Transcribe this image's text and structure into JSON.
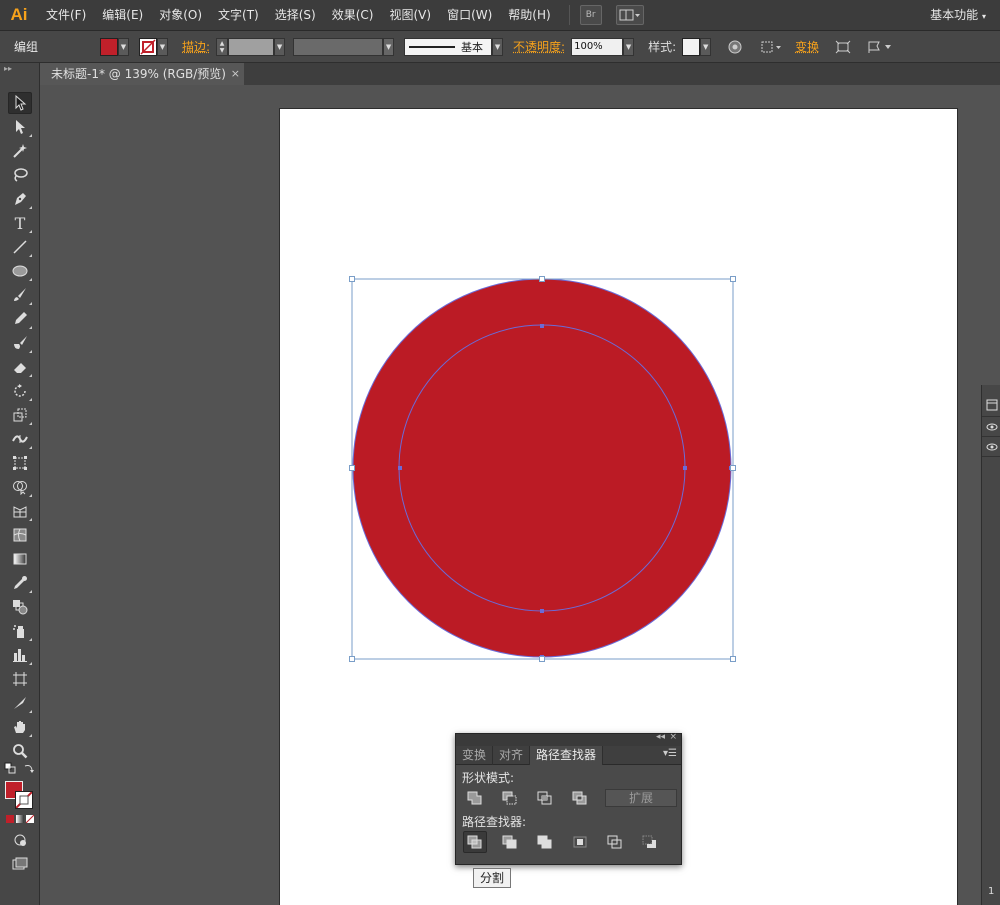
{
  "app": {
    "logo": "Ai",
    "workspace": "基本功能"
  },
  "menu": {
    "items": [
      "文件(F)",
      "编辑(E)",
      "对象(O)",
      "文字(T)",
      "选择(S)",
      "效果(C)",
      "视图(V)",
      "窗口(W)",
      "帮助(H)"
    ],
    "bridge_label": "Br"
  },
  "control_bar": {
    "selection_type": "编组",
    "fill_color": "#c0202a",
    "stroke_label": "描边:",
    "stroke_style": "基本",
    "opacity_label": "不透明度:",
    "opacity_value": "100%",
    "style_label": "样式:",
    "transform_label": "变换"
  },
  "document": {
    "tab_title": "未标题-1* @ 139% (RGB/预览)",
    "tab_close": "×"
  },
  "artwork": {
    "fill_color": "#bb1b25",
    "path_color": "#6b6bd8",
    "selection_color": "#7a9ec8"
  },
  "pathfinder_panel": {
    "tabs": [
      "变换",
      "对齐",
      "路径查找器"
    ],
    "active_tab": 2,
    "shape_modes_label": "形状模式:",
    "expand_label": "扩展",
    "pathfinders_label": "路径查找器:",
    "tooltip": "分割"
  },
  "right_strip": {
    "page_number": "1"
  }
}
